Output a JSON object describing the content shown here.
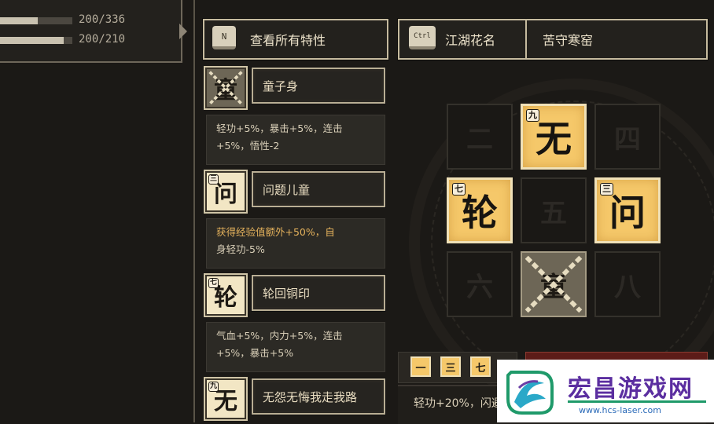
{
  "stats": [
    {
      "text": "200/336",
      "fraction": 0.52
    },
    {
      "text": "200/210",
      "fraction": 0.88
    }
  ],
  "actions": {
    "view_traits": {
      "key": "N",
      "label": "查看所有特性"
    },
    "nickname": {
      "key": "Ctrl",
      "label": "江湖花名",
      "value": "苦守寒窑"
    }
  },
  "traits": [
    {
      "icon": "童",
      "badge": "",
      "name": "童子身",
      "locked": true,
      "desc": "轻功+5%，暴击+5%，连击+5%，悟性-2",
      "desc_highlight": "",
      "desc_rest": ""
    },
    {
      "icon": "问",
      "badge": "三",
      "name": "问题儿童",
      "locked": false,
      "desc": "",
      "desc_highlight": "获得经验值额外+50%，自",
      "desc_rest": "身轻功-5%"
    },
    {
      "icon": "轮",
      "badge": "七",
      "name": "轮回铜印",
      "locked": false,
      "desc": "气血+5%，内力+5%，连击+5%，暴击+5%",
      "desc_highlight": "",
      "desc_rest": ""
    },
    {
      "icon": "无",
      "badge": "九",
      "name": "无怨无悔我走我路",
      "locked": false,
      "desc": "",
      "desc_highlight": "",
      "desc_rest": ""
    }
  ],
  "grid": [
    {
      "char": "二",
      "badge": "",
      "state": "empty"
    },
    {
      "char": "无",
      "badge": "九",
      "state": "gold"
    },
    {
      "char": "四",
      "badge": "",
      "state": "empty"
    },
    {
      "char": "轮",
      "badge": "七",
      "state": "gold"
    },
    {
      "char": "五",
      "badge": "",
      "state": "empty"
    },
    {
      "char": "问",
      "badge": "三",
      "state": "gold"
    },
    {
      "char": "六",
      "badge": "",
      "state": "empty"
    },
    {
      "char": "童",
      "badge": "",
      "state": "locked"
    },
    {
      "char": "八",
      "badge": "",
      "state": "empty"
    }
  ],
  "bottom_tags": [
    "一",
    "三",
    "七"
  ],
  "bottom_desc": "轻功+20%，闪避",
  "watermark": {
    "title": "宏昌游戏网",
    "url": "www.hcs-laser.com"
  },
  "colors": {
    "gold": "#f5c86a",
    "highlight_text": "#e5b25c",
    "frame": "#c6bb9f"
  }
}
